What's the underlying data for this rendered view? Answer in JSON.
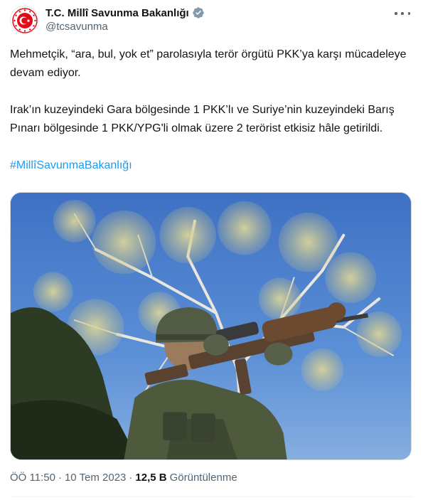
{
  "author": {
    "display_name": "T.C. Millî Savunma Bakanlığı",
    "handle": "@tcsavunma",
    "avatar_icon": "ministry-emblem-icon",
    "verified_icon": "verified-badge-icon",
    "verified_color": "#829aab"
  },
  "tweet": {
    "paragraph1": "Mehmetçik, “ara, bul, yok et” parolasıyla terör örgütü PKK’ya karşı mücadeleye devam ediyor.",
    "paragraph2": "Irak’ın kuzeyindeki Gara bölgesinde 1 PKK’lı ve Suriye’nin kuzeyindeki Barış Pınarı bölgesinde 1 PKK/YPG'li olmak üzere 2 terörist etkisiz hâle getirildi.",
    "hashtag": "#MillîSavunmaBakanlığı"
  },
  "meta": {
    "time": "ÖÖ 11:50",
    "separator": "·",
    "date": "10 Tem 2023",
    "views_count": "12,5 B",
    "views_label": "Görüntülenme"
  },
  "colors": {
    "link": "#1d9bf0",
    "text": "#0f1419",
    "secondary": "#536471",
    "emblem_red": "#e30a17"
  }
}
